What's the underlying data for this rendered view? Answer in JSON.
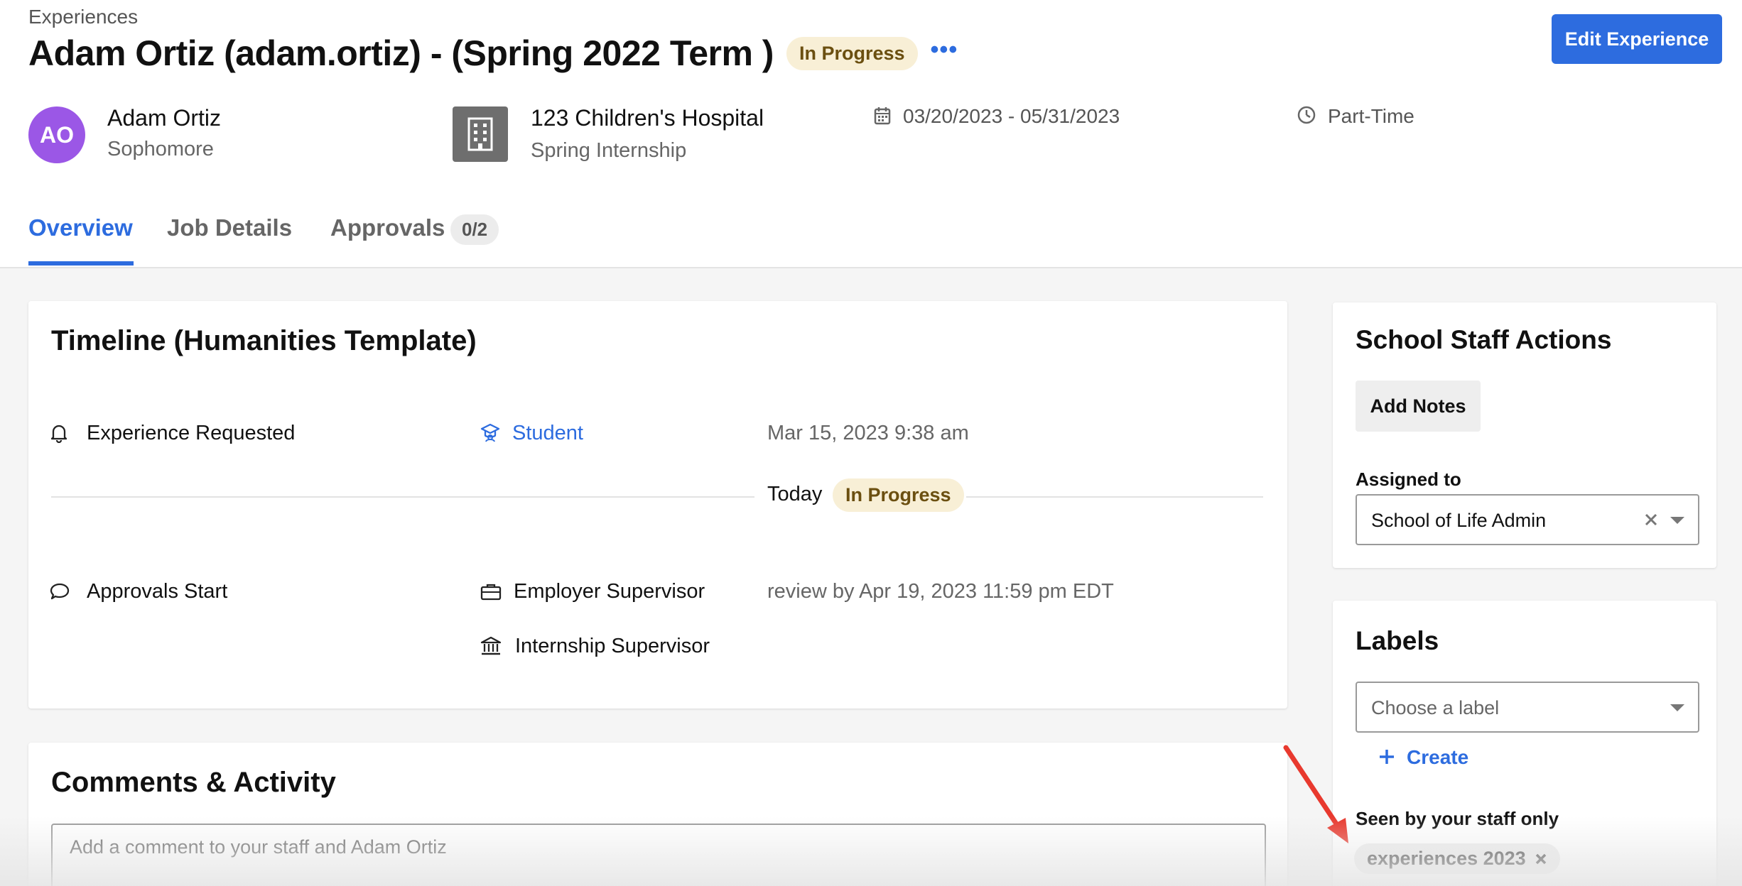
{
  "header": {
    "breadcrumb": "Experiences",
    "title": "Adam Ortiz (adam.ortiz) - (Spring 2022 Term )",
    "status_badge": "In Progress",
    "more_label": "•••",
    "edit_button": "Edit Experience"
  },
  "student": {
    "initials": "AO",
    "name": "Adam Ortiz",
    "year": "Sophomore"
  },
  "employer": {
    "name": "123 Children's Hospital",
    "position": "Spring Internship"
  },
  "dates": "03/20/2023 - 05/31/2023",
  "schedule": "Part-Time",
  "tabs": [
    {
      "label": "Overview"
    },
    {
      "label": "Job Details"
    },
    {
      "label": "Approvals"
    }
  ],
  "approvals_count": "0/2",
  "timeline": {
    "title": "Timeline (Humanities Template)",
    "rows": [
      {
        "event": "Experience Requested",
        "actor": "Student",
        "time": "Mar 15, 2023 9:38 am"
      },
      {
        "event": "Approvals Start",
        "actor": "Employer Supervisor",
        "actor2": "Internship Supervisor",
        "time": "review by Apr 19, 2023 11:59 pm EDT"
      }
    ],
    "today_label": "Today",
    "today_status": "In Progress"
  },
  "comments": {
    "title": "Comments & Activity",
    "placeholder": "Add a comment to your staff and Adam Ortiz"
  },
  "staff_actions": {
    "title": "School Staff Actions",
    "add_notes": "Add Notes",
    "assigned_label": "Assigned to",
    "assigned_value": "School of Life Admin"
  },
  "labels": {
    "title": "Labels",
    "placeholder": "Choose a label",
    "create": "Create",
    "staff_only": "Seen by your staff only",
    "chips": [
      "experiences 2023"
    ]
  },
  "colors": {
    "accent": "#2d6cdf",
    "avatar": "#9b57e6",
    "badge_bg": "#f8efd6",
    "badge_text": "#6b4f10",
    "annotation_arrow": "#e8392e"
  }
}
